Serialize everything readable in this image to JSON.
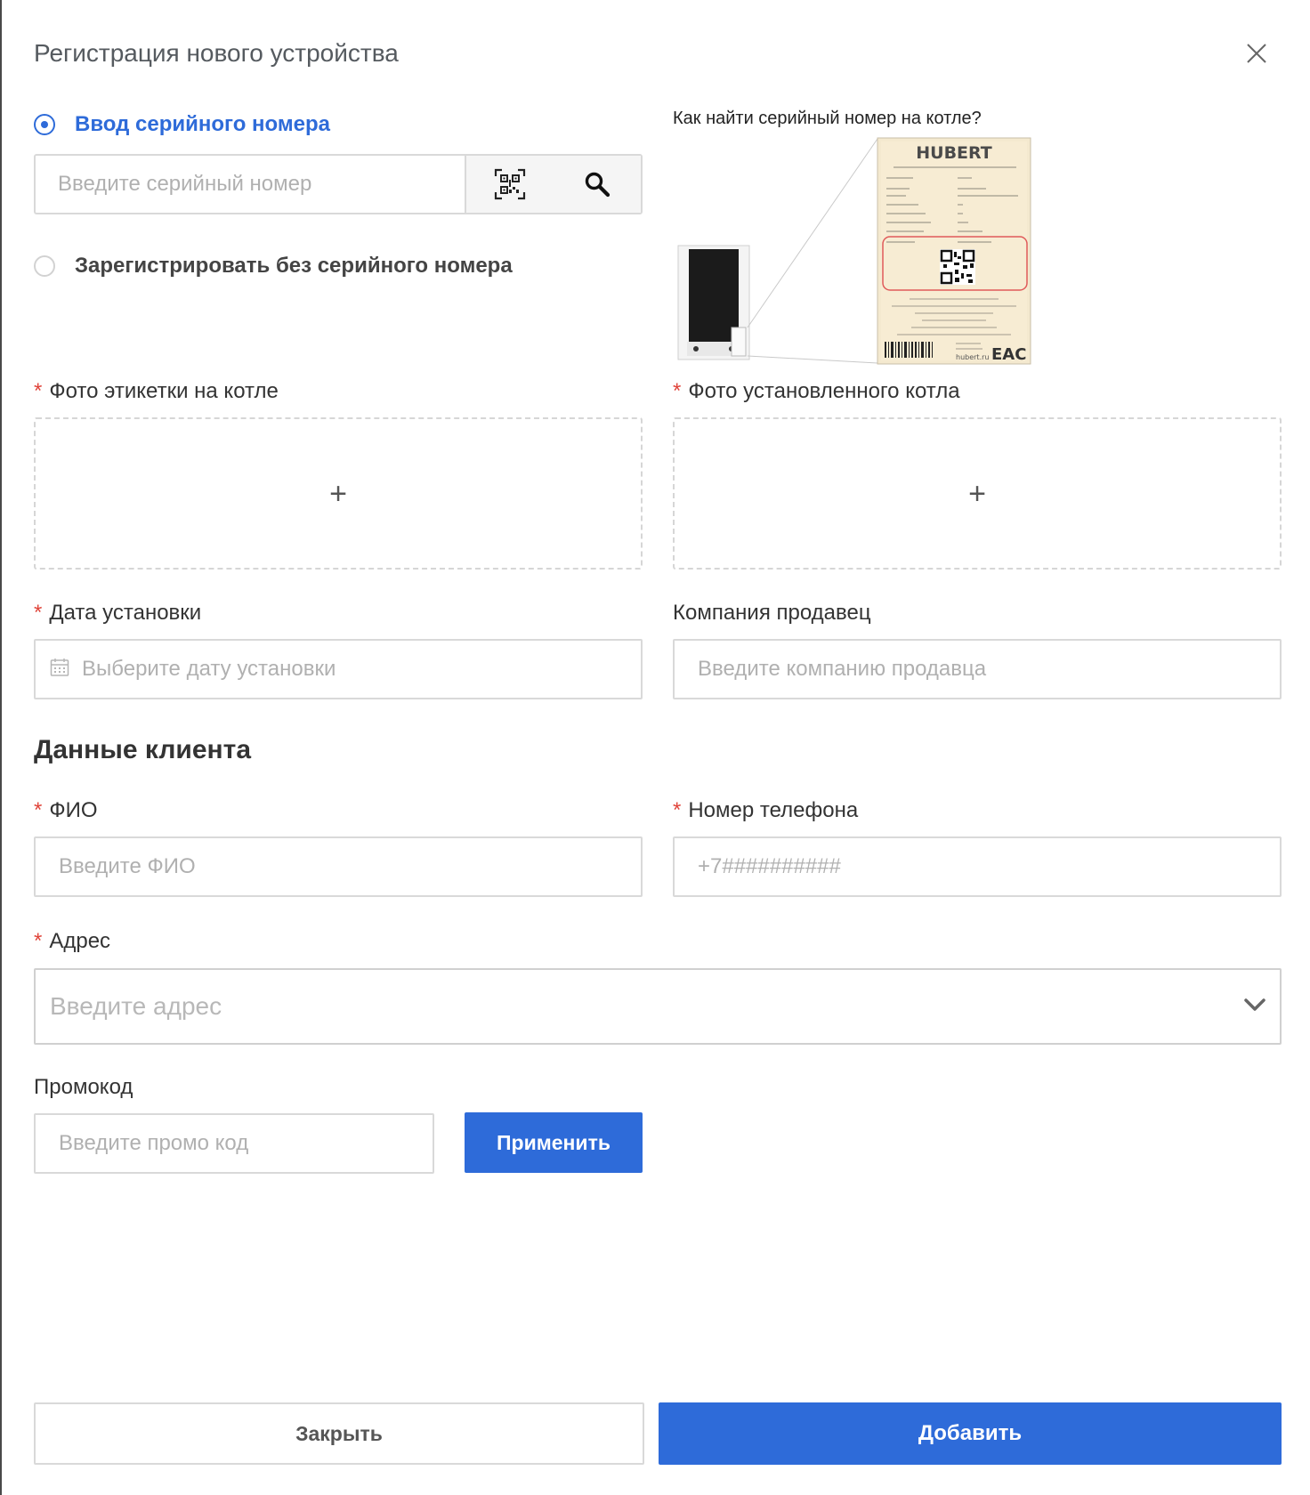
{
  "modal": {
    "title": "Регистрация нового устройства"
  },
  "serial": {
    "option_label": "Ввод серийного номера",
    "placeholder": "Введите серийный номер",
    "without_label": "Зарегистрировать без серийного номера",
    "selected": "serial"
  },
  "help": {
    "title": "Как найти серийный номер на котле?",
    "image_brand": "HUBERT",
    "image_domain": "hubert.ru",
    "image_mark": "EAC"
  },
  "uploads": {
    "label_photo": "Фото этикетки на котле",
    "installed_photo": "Фото установленного котла",
    "plus": "+"
  },
  "install": {
    "date_label": "Дата установки",
    "date_placeholder": "Выберите дату установки",
    "seller_label": "Компания продавец",
    "seller_placeholder": "Введите компанию продавца"
  },
  "client": {
    "section_title": "Данные клиента",
    "name_label": "ФИО",
    "name_placeholder": "Введите ФИО",
    "phone_label": "Номер телефона",
    "phone_placeholder": "+7##########",
    "address_label": "Адрес",
    "address_placeholder": "Введите адрес"
  },
  "promo": {
    "label": "Промокод",
    "placeholder": "Введите промо код",
    "apply": "Применить"
  },
  "footer": {
    "close": "Закрыть",
    "add": "Добавить"
  },
  "required_mark": "*",
  "colors": {
    "accent": "#2e6bd9",
    "required": "#e0443a",
    "border": "#d9d9d9",
    "placeholder": "#b0b0b0"
  },
  "icons": {
    "close": "close-icon",
    "qr": "qr-code-icon",
    "search": "search-icon",
    "calendar": "calendar-icon",
    "chevron": "chevron-down-icon",
    "plus": "plus-icon"
  }
}
